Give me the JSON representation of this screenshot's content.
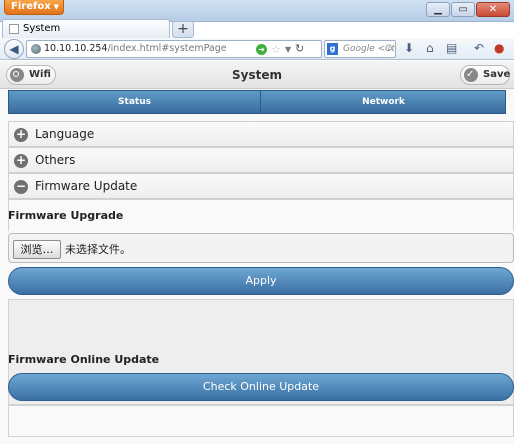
{
  "browser": {
    "menu_label": "Firefox",
    "tab_title": "System",
    "new_tab": "+",
    "url_host": "10.10.10.254",
    "url_path": "/index.html#systemPage",
    "search_placeholder": "Google <Ct"
  },
  "header": {
    "title": "System",
    "left_button": "Wifi",
    "right_button": "Save"
  },
  "nav": {
    "tabs": [
      {
        "label": "Status"
      },
      {
        "label": "Network"
      }
    ]
  },
  "sections": [
    {
      "label": "Language",
      "icon": "+"
    },
    {
      "label": "Others",
      "icon": "+"
    },
    {
      "label": "Firmware Update",
      "icon": "−"
    }
  ],
  "firmware": {
    "upgrade_label": "Firmware Upgrade",
    "browse_button": "浏览…",
    "file_status": "未选择文件。",
    "apply_button": "Apply",
    "online_label": "Firmware Online Update",
    "check_button": "Check Online Update"
  }
}
